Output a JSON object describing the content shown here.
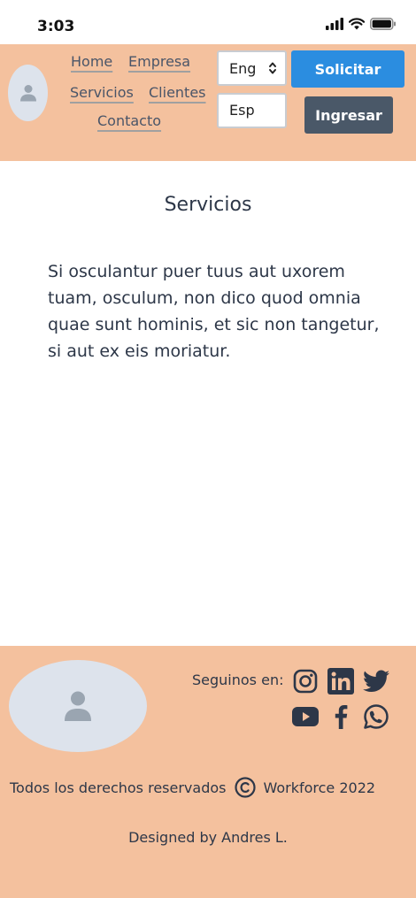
{
  "status": {
    "time": "3:03"
  },
  "header": {
    "nav": {
      "home": "Home",
      "empresa": "Empresa",
      "servicios": "Servicios",
      "clientes": "Clientes",
      "contacto": "Contacto"
    },
    "language_select": {
      "selected": "Eng"
    },
    "language_alt": "Esp",
    "solicitar_label": "Solicitar",
    "ingresar_label": "Ingresar"
  },
  "main": {
    "title": "Servicios",
    "body": "Si osculantur puer tuus aut uxorem tuam, osculum, non dico quod omnia quae sunt hominis, et sic non tangetur, si aut ex eis moriatur."
  },
  "footer": {
    "follow_label": "Seguinos en:",
    "social_icons": [
      "instagram-icon",
      "linkedin-icon",
      "twitter-icon",
      "youtube-icon",
      "facebook-icon",
      "whatsapp-icon"
    ],
    "rights_text": "Todos los derechos reservados",
    "company": "Workforce 2022",
    "designed_by": "Designed by Andres L."
  },
  "colors": {
    "header_bg": "#f4c19e",
    "primary_button": "#2b8de0",
    "secondary_button": "#4a5868",
    "avatar_bg": "#dde3ec",
    "text": "#2d3748"
  }
}
